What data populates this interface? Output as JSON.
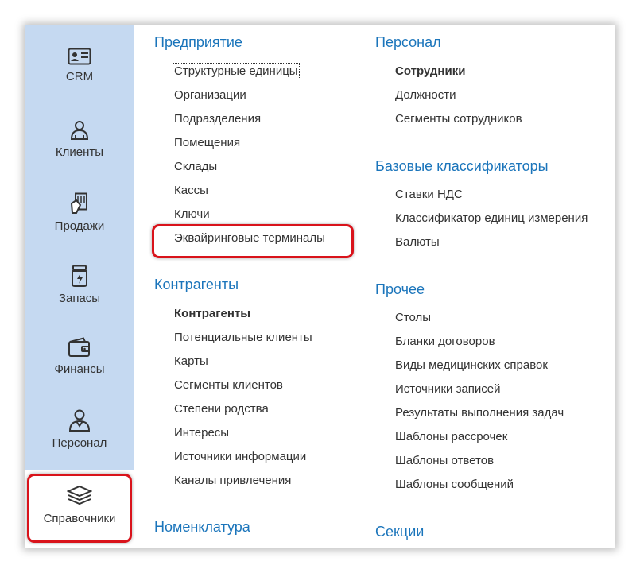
{
  "sidebar": {
    "items": [
      {
        "label": "CRM",
        "icon": "id-card-icon"
      },
      {
        "label": "Клиенты",
        "icon": "person-icon"
      },
      {
        "label": "Продажи",
        "icon": "receipt-icon"
      },
      {
        "label": "Запасы",
        "icon": "jar-icon"
      },
      {
        "label": "Финансы",
        "icon": "wallet-icon"
      },
      {
        "label": "Персонал",
        "icon": "staff-icon"
      },
      {
        "label": "Справочники",
        "icon": "stack-icon"
      }
    ],
    "active_index": 6
  },
  "sections": {
    "enterprise": {
      "title": "Предприятие",
      "items": [
        "Структурные единицы",
        "Организации",
        "Подразделения",
        "Помещения",
        "Склады",
        "Кассы",
        "Ключи",
        "Эквайринговые терминалы"
      ]
    },
    "counterparties": {
      "title": "Контрагенты",
      "items": [
        "Контрагенты",
        "Потенциальные клиенты",
        "Карты",
        "Сегменты клиентов",
        "Степени родства",
        "Интересы",
        "Источники информации",
        "Каналы привлечения"
      ]
    },
    "nomenclature": {
      "title": "Номенклатура"
    },
    "personnel": {
      "title": "Персонал",
      "items": [
        "Сотрудники",
        "Должности",
        "Сегменты сотрудников"
      ]
    },
    "base_classifiers": {
      "title": "Базовые классификаторы",
      "items": [
        "Ставки НДС",
        "Классификатор единиц измерения",
        "Валюты"
      ]
    },
    "other": {
      "title": "Прочее",
      "items": [
        "Столы",
        "Бланки договоров",
        "Виды медицинских справок",
        "Источники записей",
        "Результаты выполнения задач",
        "Шаблоны рассрочек",
        "Шаблоны ответов",
        "Шаблоны сообщений"
      ]
    },
    "sections_block": {
      "title": "Секции"
    }
  },
  "colors": {
    "sidebar_bg": "#c5d9f1",
    "section_title": "#1b75bb",
    "highlight": "#d9131b"
  }
}
